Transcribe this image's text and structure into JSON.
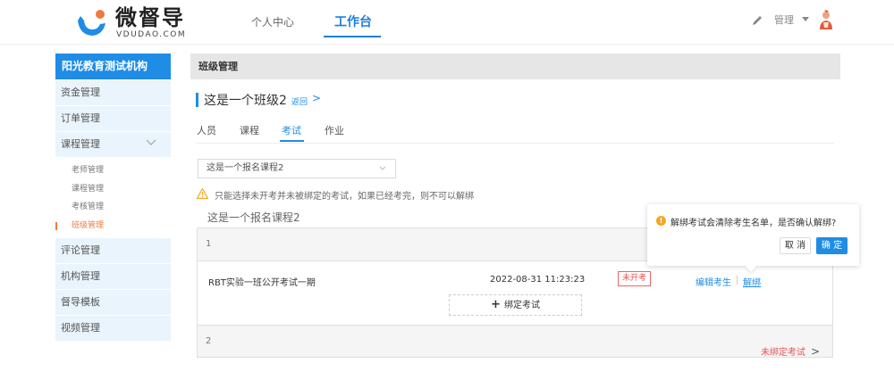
{
  "header": {
    "logo_text": "微督导",
    "logo_sub": "VDUDAO.COM",
    "nav": [
      {
        "label": "个人中心"
      },
      {
        "label": "工作台"
      }
    ],
    "user_name": "管理",
    "icons": {
      "edit": "pencil-icon",
      "caret": "caret-down-icon",
      "avatar": "user-avatar-icon"
    }
  },
  "sidebar": {
    "org": "阳光教育测试机构",
    "items": [
      {
        "label": "资金管理"
      },
      {
        "label": "订单管理"
      },
      {
        "label": "课程管理"
      }
    ],
    "sub_items": [
      {
        "label": "老师管理"
      },
      {
        "label": "课程管理"
      },
      {
        "label": "考核管理"
      },
      {
        "label": "班级管理"
      }
    ],
    "items_after": [
      {
        "label": "评论管理"
      },
      {
        "label": "机构管理"
      },
      {
        "label": "督导模板"
      },
      {
        "label": "视频管理"
      }
    ],
    "accent": "#1f8ce6",
    "active_color": "#f07a3c"
  },
  "main": {
    "breadcrumb": "班级管理",
    "class_title": "这是一个班级2",
    "back_label": "返回",
    "back_arrow": ">",
    "tabs": [
      {
        "label": "人员"
      },
      {
        "label": "课程"
      },
      {
        "label": "考试"
      },
      {
        "label": "作业"
      }
    ],
    "course_select": "这是一个报名课程2",
    "warning": "只能选择未开考并未被绑定的考试，如果已经考完，则不可以解绑",
    "course_title": "这是一个报名课程2",
    "groups": [
      {
        "index": "1"
      },
      {
        "index": "2",
        "status_link": "未绑定考试",
        "arrow": ">"
      }
    ],
    "exam": {
      "name": "RBT实验一班公开考试一期",
      "date": "2022-08-31 11:23:23",
      "badge": "未开考",
      "edit_label": "编辑考生",
      "unbind_label": "解绑"
    },
    "bind_button": "绑定考试",
    "bind_plus": "+"
  },
  "popover": {
    "message": "解绑考试会清除考生名单，是否确认解绑?",
    "cancel": "取 消",
    "confirm": "确 定",
    "icon_glyph": "!"
  }
}
